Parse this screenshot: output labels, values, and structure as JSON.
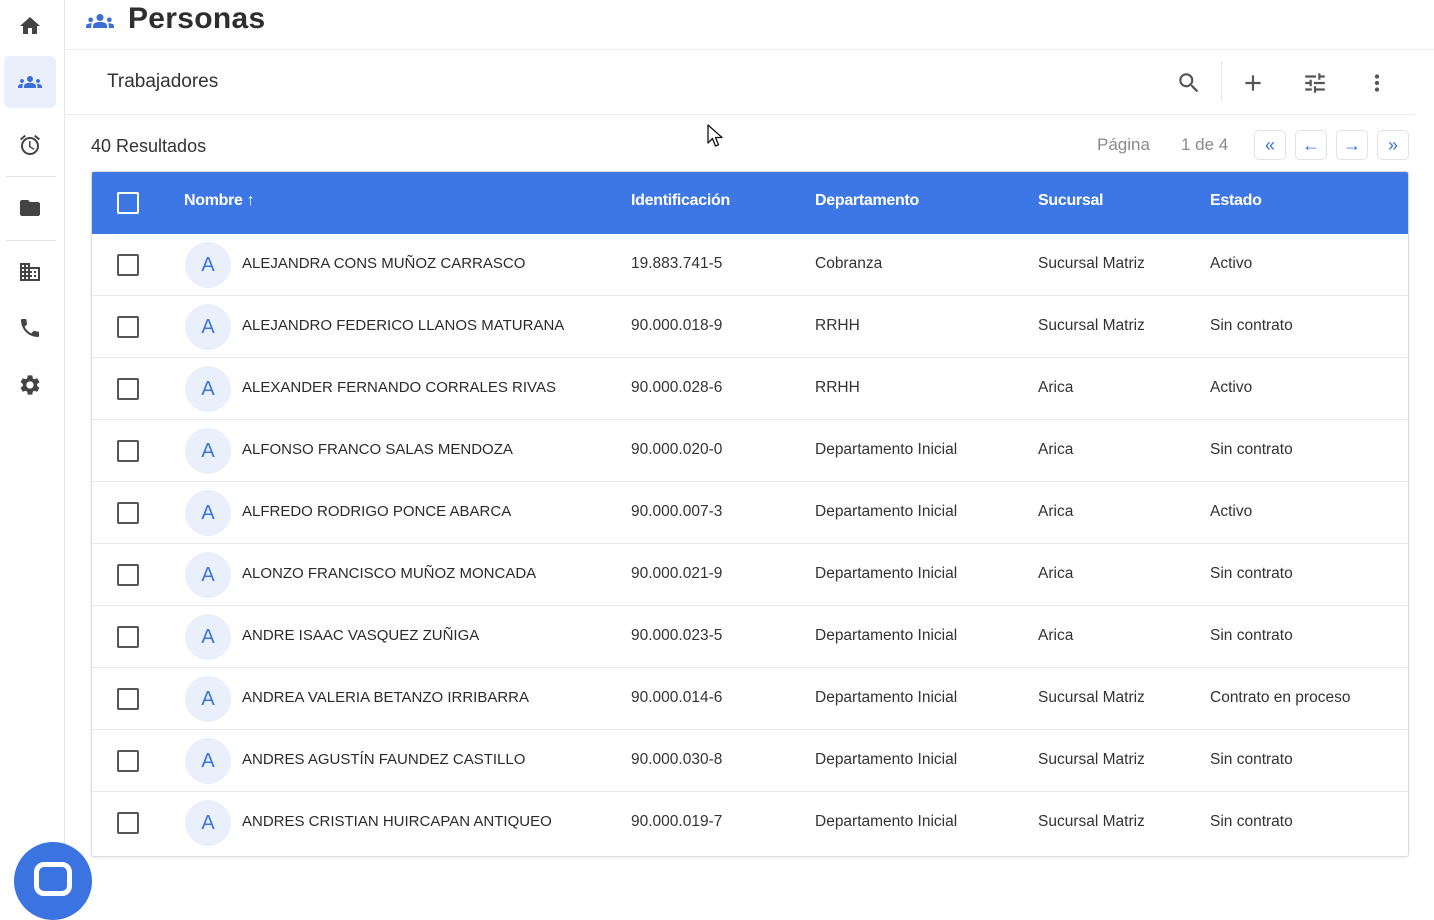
{
  "nav": {
    "items": [
      {
        "name": "home",
        "icon": "home-icon",
        "active": false
      },
      {
        "name": "people",
        "icon": "people-icon",
        "active": true
      },
      {
        "name": "clock",
        "icon": "alarm-clock-icon",
        "active": false
      },
      {
        "name": "folder",
        "icon": "folder-icon",
        "active": false
      },
      {
        "name": "building",
        "icon": "building-icon",
        "active": false
      },
      {
        "name": "phone",
        "icon": "phone-icon",
        "active": false
      },
      {
        "name": "settings",
        "icon": "gear-icon",
        "active": false
      }
    ]
  },
  "header": {
    "title": "Personas",
    "icon": "people-icon"
  },
  "subbar": {
    "section_title": "Trabajadores",
    "tools": [
      "search-icon",
      "add-icon",
      "tune-icon",
      "more-vert-icon"
    ]
  },
  "results": {
    "label": "40 Resultados"
  },
  "pager": {
    "label": "Página",
    "count": "1 de 4",
    "first": "«",
    "prev": "←",
    "next": "→",
    "last": "»"
  },
  "table": {
    "columns": {
      "name": "Nombre",
      "sort_arrow": "↑",
      "ident": "Identificación",
      "dep": "Departamento",
      "suc": "Sucursal",
      "est": "Estado"
    },
    "rows": [
      {
        "initial": "A",
        "name": "ALEJANDRA CONS MUÑOZ CARRASCO",
        "ident": "19.883.741-5",
        "dep": "Cobranza",
        "suc": "Sucursal Matriz",
        "est": "Activo"
      },
      {
        "initial": "A",
        "name": "ALEJANDRO FEDERICO LLANOS MATURANA",
        "ident": "90.000.018-9",
        "dep": "RRHH",
        "suc": "Sucursal Matriz",
        "est": "Sin contrato"
      },
      {
        "initial": "A",
        "name": "ALEXANDER FERNANDO CORRALES RIVAS",
        "ident": "90.000.028-6",
        "dep": "RRHH",
        "suc": "Arica",
        "est": "Activo"
      },
      {
        "initial": "A",
        "name": "ALFONSO FRANCO SALAS MENDOZA",
        "ident": "90.000.020-0",
        "dep": "Departamento Inicial",
        "suc": "Arica",
        "est": "Sin contrato"
      },
      {
        "initial": "A",
        "name": "ALFREDO RODRIGO PONCE ABARCA",
        "ident": "90.000.007-3",
        "dep": "Departamento Inicial",
        "suc": "Arica",
        "est": "Activo"
      },
      {
        "initial": "A",
        "name": "ALONZO FRANCISCO MUÑOZ MONCADA",
        "ident": "90.000.021-9",
        "dep": "Departamento Inicial",
        "suc": "Arica",
        "est": "Sin contrato"
      },
      {
        "initial": "A",
        "name": "ANDRE ISAAC VASQUEZ ZUÑIGA",
        "ident": "90.000.023-5",
        "dep": "Departamento Inicial",
        "suc": "Arica",
        "est": "Sin contrato"
      },
      {
        "initial": "A",
        "name": "ANDREA VALERIA BETANZO IRRIBARRA",
        "ident": "90.000.014-6",
        "dep": "Departamento Inicial",
        "suc": "Sucursal Matriz",
        "est": "Contrato en proceso"
      },
      {
        "initial": "A",
        "name": "ANDRES AGUSTÍN FAUNDEZ CASTILLO",
        "ident": "90.000.030-8",
        "dep": "Departamento Inicial",
        "suc": "Sucursal Matriz",
        "est": "Sin contrato"
      },
      {
        "initial": "A",
        "name": "ANDRES CRISTIAN HUIRCAPAN ANTIQUEO",
        "ident": "90.000.019-7",
        "dep": "Departamento Inicial",
        "suc": "Sucursal Matriz",
        "est": "Sin contrato"
      }
    ]
  },
  "colors": {
    "accent": "#3d77e6",
    "avatar_bg": "#eaf0fb"
  }
}
